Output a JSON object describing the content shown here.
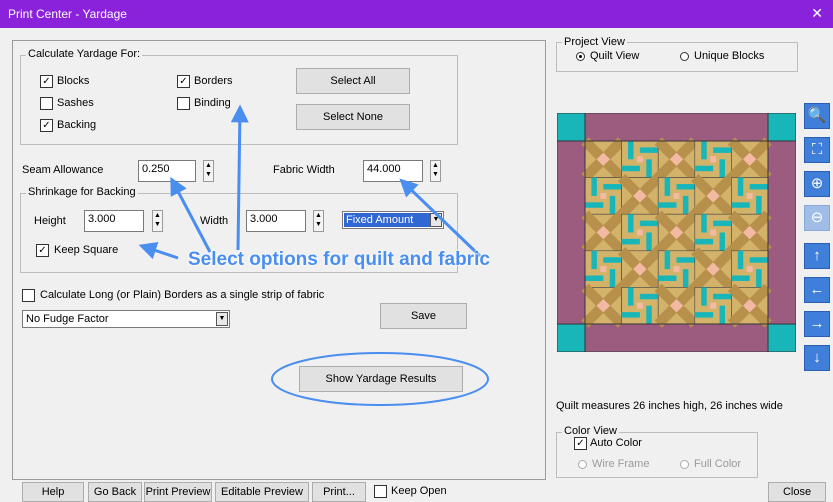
{
  "window": {
    "title": "Print Center - Yardage",
    "close_glyph": "✕"
  },
  "calc_group": {
    "label": "Calculate Yardage For:",
    "blocks": "Blocks",
    "borders": "Borders",
    "sashes": "Sashes",
    "binding": "Binding",
    "backing": "Backing",
    "check_glyph": "✓",
    "select_all": "Select All",
    "select_none": "Select None"
  },
  "seam": {
    "label": "Seam Allowance",
    "value": "0.250"
  },
  "fabric_width": {
    "label": "Fabric Width",
    "value": "44.000"
  },
  "shrinkage": {
    "label": "Shrinkage for Backing",
    "height_label": "Height",
    "height_value": "3.000",
    "width_label": "Width",
    "width_value": "3.000",
    "mode": "Fixed Amount",
    "keep_square": "Keep Square"
  },
  "long_borders": "Calculate Long (or Plain) Borders as a single strip of fabric",
  "fudge": "No Fudge Factor",
  "save": "Save",
  "show_results": "Show Yardage Results",
  "annotation": "Select options for quilt and fabric",
  "project_view": {
    "label": "Project View",
    "quilt_view": "Quilt View",
    "unique_blocks": "Unique Blocks"
  },
  "quilt_measure": "Quilt measures 26 inches high, 26 inches wide",
  "color_view": {
    "label": "Color View",
    "auto_color": "Auto Color",
    "wire_frame": "Wire Frame",
    "full_color": "Full Color"
  },
  "toolbar_icons": [
    "zoom-icon",
    "fit-icon",
    "zoom-in-icon",
    "zoom-out-icon",
    "arrow-up-icon",
    "arrow-left-icon",
    "arrow-right-icon",
    "arrow-down-icon"
  ],
  "toolbar_glyphs": [
    "🔍",
    "⛶",
    "⊕",
    "⊖",
    "↑",
    "←",
    "→",
    "↓"
  ],
  "bottom": {
    "help": "Help",
    "go_back": "Go Back",
    "print_preview": "Print Preview",
    "editable_preview": "Editable Preview",
    "print": "Print...",
    "keep_open": "Keep Open",
    "close": "Close"
  },
  "colors": {
    "title_bar": "#8a22dc",
    "annotation": "#4a8ef0",
    "quilt_border": "#9c5c80",
    "quilt_teal": "#19b6b9",
    "quilt_tan": "#d3b26a",
    "quilt_peach": "#f3b9a2",
    "quilt_gold": "#b7904c",
    "toolbar_blue": "#3f7fd9"
  }
}
